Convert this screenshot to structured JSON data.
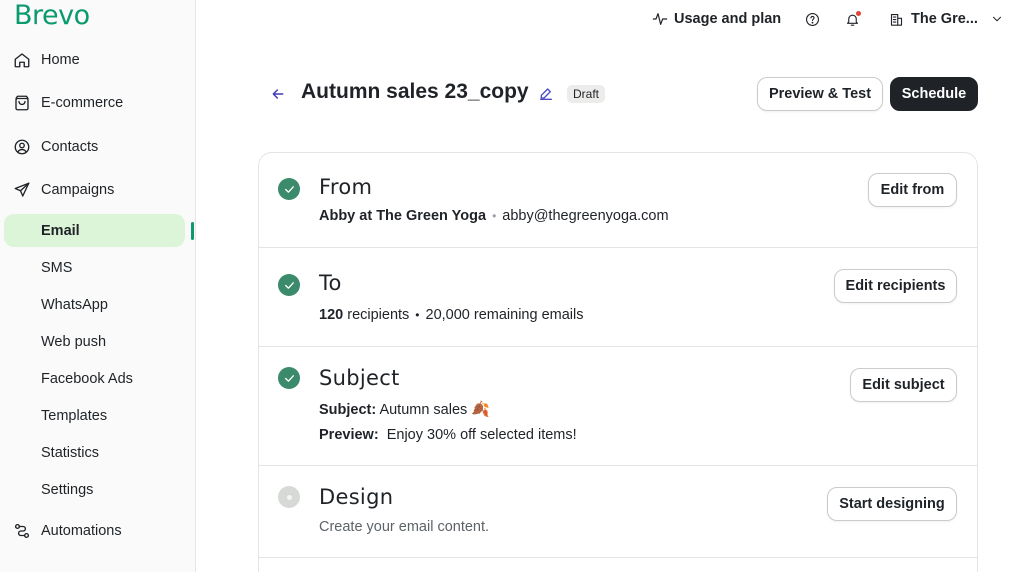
{
  "brand": {
    "logo_text": "Brevo",
    "accent": "#0b996e"
  },
  "sidebar": {
    "items": [
      {
        "label": "Home",
        "icon": "home-icon"
      },
      {
        "label": "E-commerce",
        "icon": "shopping-bag-icon"
      },
      {
        "label": "Contacts",
        "icon": "contacts-icon"
      },
      {
        "label": "Campaigns",
        "icon": "send-icon"
      }
    ],
    "campaigns_sub": [
      {
        "label": "Email",
        "active": true
      },
      {
        "label": "SMS"
      },
      {
        "label": "WhatsApp"
      },
      {
        "label": "Web push"
      },
      {
        "label": "Facebook Ads"
      },
      {
        "label": "Templates"
      },
      {
        "label": "Statistics"
      },
      {
        "label": "Settings"
      }
    ],
    "automations": {
      "label": "Automations",
      "icon": "automations-icon"
    }
  },
  "topbar": {
    "usage_label": "Usage and plan",
    "help_icon": "help-icon",
    "bell_icon": "bell-icon",
    "account_label": "The Gre...",
    "account_icon": "building-icon",
    "chevron_icon": "chevron-down-icon"
  },
  "header": {
    "title": "Autumn sales 23_copy",
    "status": "Draft",
    "preview_label": "Preview & Test",
    "schedule_label": "Schedule"
  },
  "sections": {
    "from": {
      "title": "From",
      "sender_name": "Abby at The Green Yoga",
      "sender_email": "abby@thegreenyoga.com",
      "button": "Edit from",
      "complete": true
    },
    "to": {
      "title": "To",
      "recipients_count": "120",
      "recipients_word": "recipients",
      "remaining": "20,000 remaining emails",
      "button": "Edit recipients",
      "complete": true
    },
    "subject": {
      "title": "Subject",
      "subject_label": "Subject:",
      "subject_value": "Autumn sales",
      "preview_label": "Preview:",
      "preview_value": "Enjoy 30% off selected items!",
      "button": "Edit subject",
      "complete": true
    },
    "design": {
      "title": "Design",
      "description": "Create your email content.",
      "button": "Start designing",
      "complete": false
    }
  }
}
